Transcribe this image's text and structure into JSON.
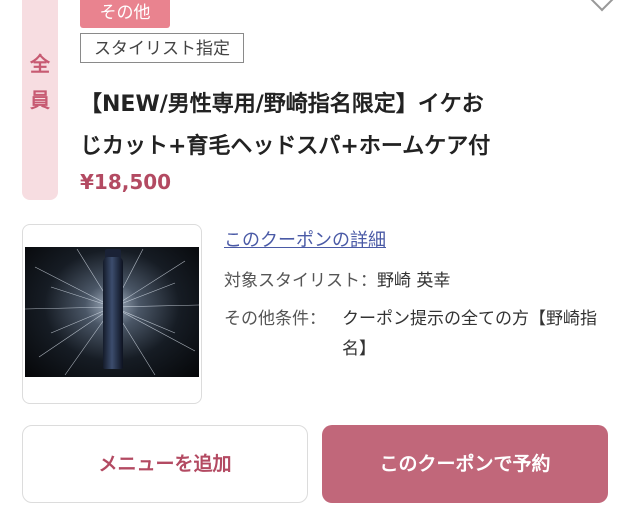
{
  "side_label": [
    "全",
    "員"
  ],
  "tags": {
    "category": "その他",
    "stylist": "スタイリスト指定"
  },
  "coupon": {
    "title_line1": "【NEW/男性専用/野崎指名限定】イケお",
    "title_line2": "じカット+育毛ヘッドスパ+ホームケア付",
    "price": "¥18,500",
    "detail_link": "このクーポンの詳細",
    "stylist_label": "対象スタイリスト：",
    "stylist_value": "野崎 英幸",
    "conditions_label": "その他条件：",
    "conditions_value": "クーポン提示の全ての方【野崎指名】"
  },
  "buttons": {
    "add_menu": "メニューを追加",
    "reserve": "このクーポンで予約"
  },
  "colors": {
    "accent": "#c1677a",
    "price": "#b34a62",
    "tag_bg": "#e9838f",
    "side_strip": "#f7dde1",
    "link": "#4a5aa6"
  }
}
